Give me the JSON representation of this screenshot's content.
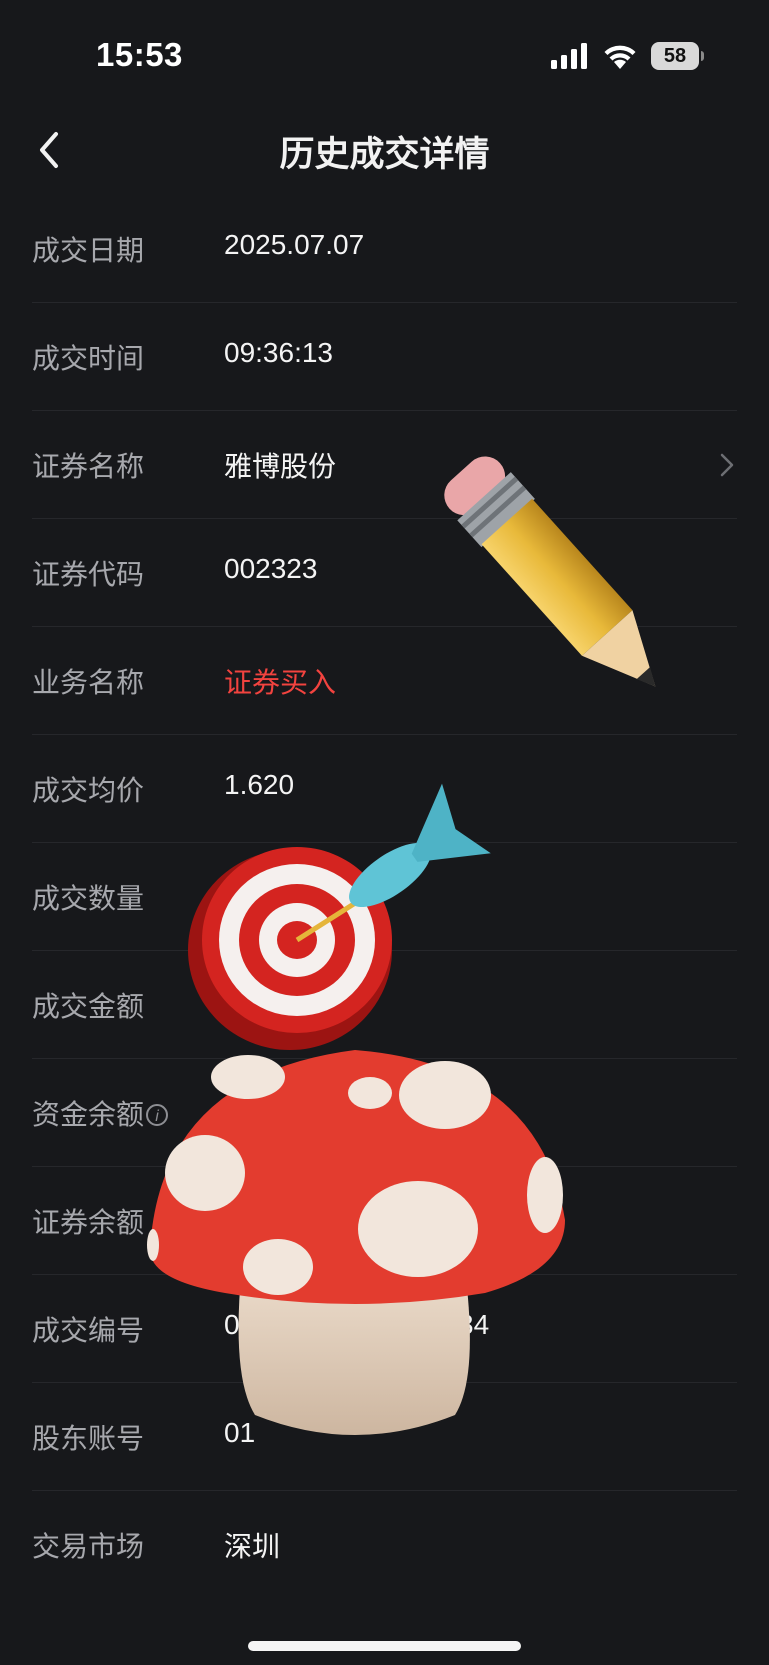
{
  "status_bar": {
    "time": "15:53",
    "battery": "58",
    "icons": [
      "signal-icon",
      "wifi-icon",
      "battery-icon"
    ]
  },
  "nav": {
    "title": "历史成交详情",
    "back_icon": "chevron-left-icon"
  },
  "rows": [
    {
      "label": "成交日期",
      "value": "2025.07.07"
    },
    {
      "label": "成交时间",
      "value": "09:36:13"
    },
    {
      "label": "证券名称",
      "value": "雅博股份"
    },
    {
      "label": "证券代码",
      "value": "002323"
    },
    {
      "label": "业务名称",
      "value": "证券买入"
    },
    {
      "label": "成交均价",
      "value": "1.620"
    },
    {
      "label": "成交数量",
      "value": ""
    },
    {
      "label": "成交金额",
      "value": ""
    },
    {
      "label": "资金余额",
      "value": ""
    },
    {
      "label": "证券余额",
      "value": ""
    },
    {
      "label": "成交编号",
      "value": "01",
      "value_tail": "34"
    },
    {
      "label": "股东账号",
      "value": "01"
    },
    {
      "label": "交易市场",
      "value": "深圳"
    }
  ],
  "colors": {
    "background": "#17181b",
    "label": "#a7a8ad",
    "value": "#f4f4f4",
    "buy": "#f2433f",
    "divider": "#26272b"
  },
  "stickers": [
    "pencil-sticker",
    "target-sticker",
    "mushroom-sticker"
  ]
}
